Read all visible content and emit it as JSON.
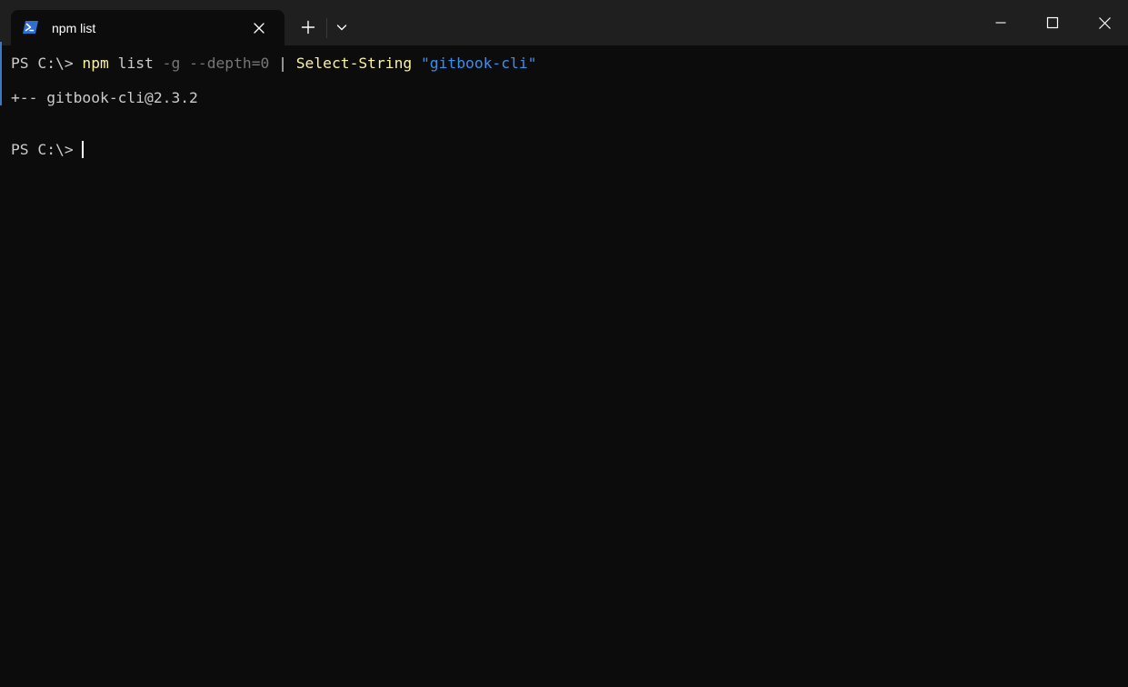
{
  "window": {
    "tab_title": "npm list",
    "icons": {
      "tab": "powershell-icon",
      "tab_close": "close-icon",
      "new_tab": "plus-icon",
      "dropdown": "chevron-down-icon",
      "minimize": "minimize-icon",
      "maximize": "maximize-icon",
      "close": "close-icon"
    }
  },
  "terminal": {
    "command_line": {
      "prompt": "PS C:\\> ",
      "command": "npm",
      "arg": " list ",
      "param_g": "-g",
      "space": " ",
      "param_depth": "--depth=0",
      "pipe": " | ",
      "cmdlet": "Select-String",
      "space2": " ",
      "string": "\"gitbook-cli\""
    },
    "output": "+-- gitbook-cli@2.3.2",
    "current_prompt": "PS C:\\> "
  },
  "colors": {
    "background": "#0c0c0c",
    "titlebar": "#1f1f1f",
    "command": "#f9f1a5",
    "parameter": "#767676",
    "string": "#3b8eea",
    "text": "#cccccc"
  }
}
